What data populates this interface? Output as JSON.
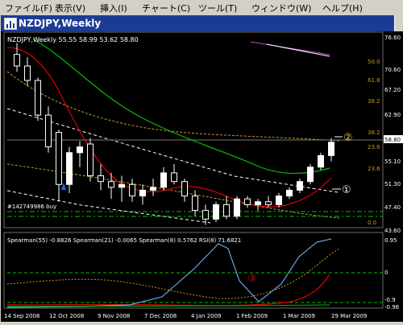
{
  "menu": [
    {
      "label": "ファイル(F)"
    },
    {
      "label": "表示(V)"
    },
    {
      "label": "挿入(I)"
    },
    {
      "label": "チャート(C)"
    },
    {
      "label": "ツール(T)"
    },
    {
      "label": "ウィンドウ(W)"
    },
    {
      "label": "ヘルプ(H)"
    }
  ],
  "window": {
    "title": "NZDJPY,Weekly"
  },
  "price_panel": {
    "header": "NZDJPY,Weekly  55.55 58.99 53.62 58.80",
    "price_axis": [
      "76.60",
      "70.60",
      "67.20",
      "62.90",
      "58.80",
      "55.10",
      "51.30",
      "47.40",
      "43.60"
    ],
    "current_price": "58.80",
    "fib_labels": [
      "50.0",
      "61.8",
      "38.2",
      "38.2",
      "23.6",
      "23.6",
      "0.0"
    ],
    "order_label": "#142749986 buy",
    "annotations": [
      "①",
      "②"
    ]
  },
  "indicator_panel": {
    "header": "Spearman(55) -0.8826  Spearman(21) -0.0065  Spearman(8) 0.5762  RSI(8) 71.6821",
    "axis": [
      "0.95",
      "0",
      "-0.9",
      "-0.98"
    ],
    "annotation": "③"
  },
  "time_axis": [
    "14 Sep 2008",
    "12 Oct 2008",
    "9 Nov 2008",
    "7 Dec 2008",
    "4 Jan 2009",
    "1 Feb 2009",
    "1 Mar 2009",
    "29 Mar 2009"
  ],
  "colors": {
    "background": "#000000",
    "bull_candle": "#ffffff",
    "bear_candle": "#000000",
    "ma_fast": "#e00000",
    "ma_slow": "#00c000",
    "dashed_white": "#ffffff",
    "dashed_orange": "#c8962a",
    "spearman_blue": "#6aa0e0",
    "titlebar": "#1c3c94"
  },
  "candles": [
    {
      "o": 74.0,
      "h": 76.0,
      "l": 71.0,
      "c": 72.0
    },
    {
      "o": 72.0,
      "h": 73.5,
      "l": 68.5,
      "c": 69.5
    },
    {
      "o": 69.5,
      "h": 70.0,
      "l": 62.5,
      "c": 63.5
    },
    {
      "o": 63.5,
      "h": 65.0,
      "l": 57.0,
      "c": 58.0
    },
    {
      "o": 60.5,
      "h": 61.0,
      "l": 48.5,
      "c": 51.5
    },
    {
      "o": 51.5,
      "h": 58.0,
      "l": 50.0,
      "c": 57.0
    },
    {
      "o": 57.0,
      "h": 59.0,
      "l": 54.5,
      "c": 58.0
    },
    {
      "o": 58.5,
      "h": 59.5,
      "l": 52.0,
      "c": 53.0
    },
    {
      "o": 53.0,
      "h": 55.0,
      "l": 50.5,
      "c": 52.0
    },
    {
      "o": 52.0,
      "h": 53.5,
      "l": 49.0,
      "c": 51.0
    },
    {
      "o": 51.0,
      "h": 53.0,
      "l": 48.5,
      "c": 51.5
    },
    {
      "o": 51.5,
      "h": 52.5,
      "l": 48.5,
      "c": 49.5
    },
    {
      "o": 49.5,
      "h": 51.5,
      "l": 48.0,
      "c": 50.5
    },
    {
      "o": 50.5,
      "h": 52.5,
      "l": 49.5,
      "c": 51.0
    },
    {
      "o": 51.0,
      "h": 54.5,
      "l": 50.5,
      "c": 53.5
    },
    {
      "o": 53.5,
      "h": 55.0,
      "l": 51.5,
      "c": 52.0
    },
    {
      "o": 52.0,
      "h": 52.5,
      "l": 48.5,
      "c": 49.5
    },
    {
      "o": 49.5,
      "h": 50.5,
      "l": 46.0,
      "c": 47.0
    },
    {
      "o": 47.0,
      "h": 48.0,
      "l": 44.5,
      "c": 45.5
    },
    {
      "o": 45.5,
      "h": 48.5,
      "l": 45.0,
      "c": 48.0
    },
    {
      "o": 48.0,
      "h": 49.5,
      "l": 45.5,
      "c": 46.0
    },
    {
      "o": 46.0,
      "h": 49.5,
      "l": 45.5,
      "c": 49.0
    },
    {
      "o": 49.0,
      "h": 49.5,
      "l": 47.5,
      "c": 48.0
    },
    {
      "o": 48.0,
      "h": 49.0,
      "l": 47.0,
      "c": 48.5
    },
    {
      "o": 48.5,
      "h": 49.5,
      "l": 47.5,
      "c": 48.0
    },
    {
      "o": 48.0,
      "h": 50.0,
      "l": 47.5,
      "c": 49.5
    },
    {
      "o": 49.5,
      "h": 51.0,
      "l": 49.0,
      "c": 50.5
    },
    {
      "o": 50.5,
      "h": 52.5,
      "l": 50.0,
      "c": 52.0
    },
    {
      "o": 52.0,
      "h": 55.0,
      "l": 51.5,
      "c": 54.5
    },
    {
      "o": 54.5,
      "h": 57.0,
      "l": 54.0,
      "c": 56.5
    },
    {
      "o": 56.5,
      "h": 59.5,
      "l": 55.5,
      "c": 58.8
    }
  ]
}
